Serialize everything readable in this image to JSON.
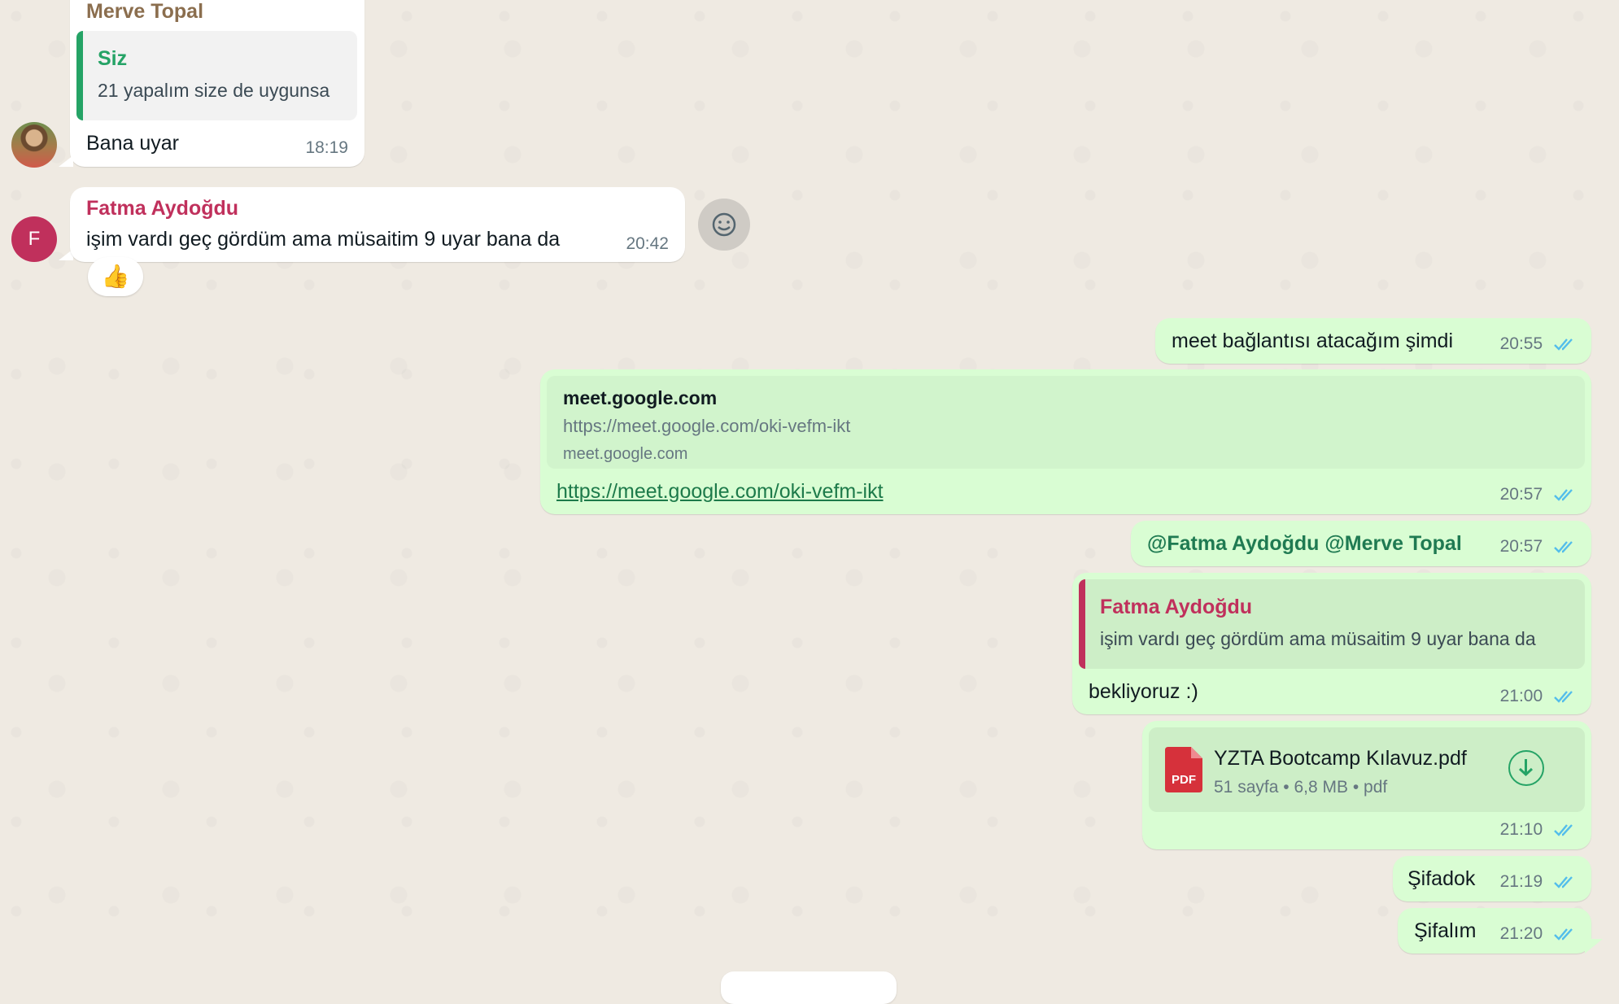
{
  "colors": {
    "accent_green": "#25a366",
    "sender_pink": "#c0305c",
    "sender_brown": "#8b6e4e",
    "tick_blue": "#53bdeb",
    "pdf_red": "#d6313b"
  },
  "messages": {
    "m1": {
      "sender": "Merve Topal",
      "quote_author": "Siz",
      "quote_text": "21 yapalım size de uygunsa",
      "text": "Bana uyar",
      "time": "18:19"
    },
    "m2": {
      "avatar_letter": "F",
      "sender": "Fatma Aydoğdu",
      "text": "işim vardı geç gördüm ama müsaitim 9 uyar bana da",
      "time": "20:42",
      "reaction": "👍",
      "emoji_button_icon": "smiley-icon"
    },
    "m3": {
      "text": "meet bağlantısı atacağım şimdi",
      "time": "20:55"
    },
    "m4": {
      "preview_title": "meet.google.com",
      "preview_url": "https://meet.google.com/oki-vefm-ikt",
      "preview_domain": "meet.google.com",
      "link": "https://meet.google.com/oki-vefm-ikt",
      "time": "20:57"
    },
    "m5": {
      "mention1": "@Fatma Aydoğdu",
      "mention2": "@Merve Topal",
      "time": "20:57"
    },
    "m6": {
      "quote_author": "Fatma Aydoğdu",
      "quote_text": "işim vardı geç gördüm ama müsaitim 9 uyar bana da",
      "text": "bekliyoruz :)",
      "time": "21:00"
    },
    "m7": {
      "file_icon_label": "PDF",
      "file_name": "YZTA Bootcamp Kılavuz.pdf",
      "pages": "51 sayfa",
      "size": "6,8 MB",
      "ext": "pdf",
      "dot": "•",
      "time": "21:10"
    },
    "m8": {
      "text": "Şifadok",
      "time": "21:19"
    },
    "m9": {
      "text": "Şifalım",
      "time": "21:20"
    }
  }
}
